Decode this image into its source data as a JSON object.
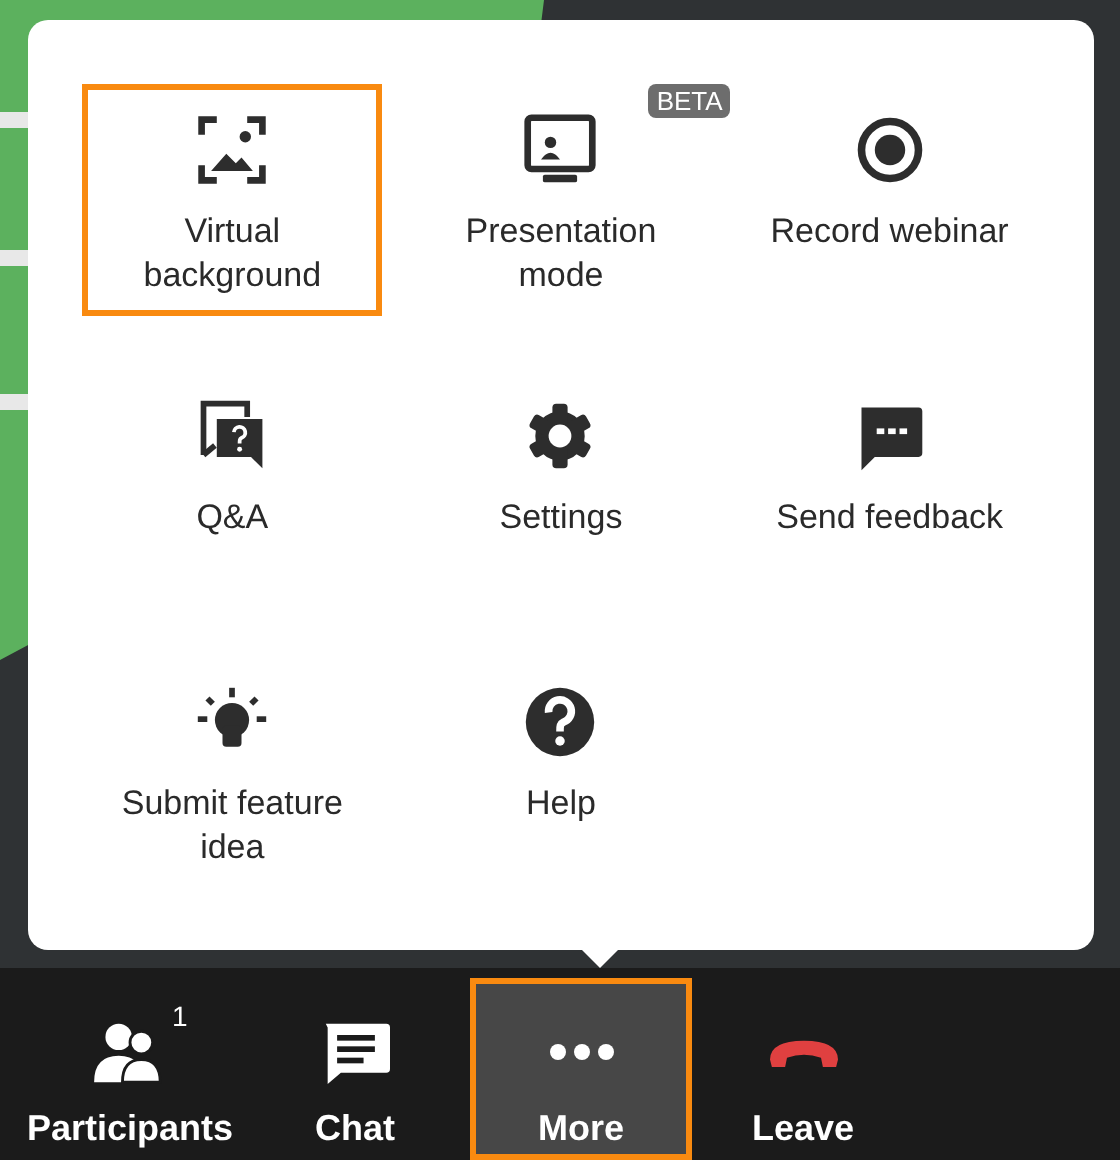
{
  "menu": {
    "items": [
      {
        "label": "Virtual background",
        "selected": true
      },
      {
        "label": "Presentation mode",
        "selected": false,
        "badge": "BETA"
      },
      {
        "label": "Record webinar",
        "selected": false
      },
      {
        "label": "Q&A",
        "selected": false
      },
      {
        "label": "Settings",
        "selected": false
      },
      {
        "label": "Send feedback",
        "selected": false
      },
      {
        "label": "Submit feature idea",
        "selected": false
      },
      {
        "label": "Help",
        "selected": false
      }
    ]
  },
  "toolbar": {
    "items": [
      {
        "label": "Participants",
        "selected": false,
        "count": "1"
      },
      {
        "label": "Chat",
        "selected": false
      },
      {
        "label": "More",
        "selected": true
      },
      {
        "label": "Leave",
        "selected": false
      }
    ]
  }
}
